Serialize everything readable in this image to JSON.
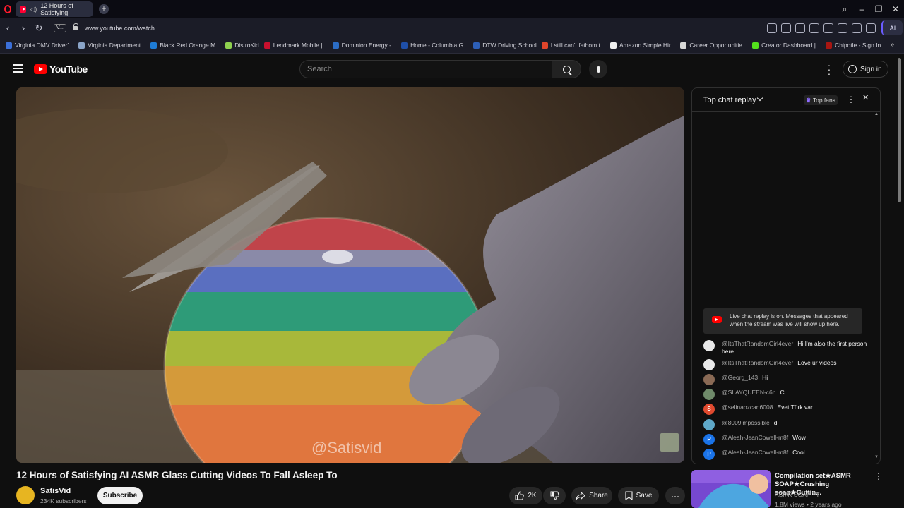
{
  "browser": {
    "tab_title": "12 Hours of Satisfying",
    "url": "www.youtube.com/watch",
    "site_badge": "V...",
    "ai_label": "AI",
    "bookmarks": [
      {
        "label": "Virginia DMV Driver'...",
        "color": "#3b6fd9"
      },
      {
        "label": "Virginia Department...",
        "color": "#8aa4c8"
      },
      {
        "label": "Black Red Orange M...",
        "color": "#1e7cd6"
      },
      {
        "label": "DistroKid",
        "color": "#8fd14f"
      },
      {
        "label": "Lendmark Mobile |...",
        "color": "#c8102e"
      },
      {
        "label": "Dominion Energy -...",
        "color": "#2b6cc4"
      },
      {
        "label": "Home - Columbia G...",
        "color": "#1f4fa8"
      },
      {
        "label": "DTW Driving School",
        "color": "#2d5fb8"
      },
      {
        "label": "I still can't fathom t...",
        "color": "#e0452b"
      },
      {
        "label": "Amazon Simple Hir...",
        "color": "#f0f0f0"
      },
      {
        "label": "Career Opportunitie...",
        "color": "#d8d8d8"
      },
      {
        "label": "Creator Dashboard |...",
        "color": "#53e01c"
      },
      {
        "label": "Chipotle - Sign In",
        "color": "#a81612"
      }
    ]
  },
  "header": {
    "logo_text": "YouTube",
    "search_placeholder": "Search",
    "signin_label": "Sign in"
  },
  "video": {
    "watermark": "@Satisvid",
    "title": "12 Hours of Satisfying AI ASMR Glass Cutting Videos To Fall Asleep To",
    "channel": "SatisVid",
    "subscribers": "234K subscribers",
    "subscribe_label": "Subscribe",
    "like_count": "2K",
    "share_label": "Share",
    "save_label": "Save"
  },
  "chat": {
    "title": "Top chat replay",
    "top_fans_label": "Top fans",
    "notice": "Live chat replay is on. Messages that appeared when the stream was live will show up here.",
    "messages": [
      {
        "author": "@ItsThatRandomGirl4ever",
        "text": "Hi I'm also the first person here",
        "avatar_color": "#e8e8e8",
        "initial": ""
      },
      {
        "author": "@ItsThatRandomGirl4ever",
        "text": "Love ur videos",
        "avatar_color": "#e8e8e8",
        "initial": ""
      },
      {
        "author": "@Georg_143",
        "text": "Hi",
        "avatar_color": "#8a6a55",
        "initial": ""
      },
      {
        "author": "@SLAYQUEEN-c6n",
        "text": "C",
        "avatar_color": "#6f8a6a",
        "initial": ""
      },
      {
        "author": "@selinaozcan6008",
        "text": "Evet Türk var",
        "avatar_color": "#e04a2f",
        "initial": "S"
      },
      {
        "author": "@8009impossible",
        "text": "d",
        "avatar_color": "#5fa8c8",
        "initial": ""
      },
      {
        "author": "@Aleah-JeanCowell-m8f",
        "text": "Wow",
        "avatar_color": "#1a73e8",
        "initial": "P"
      },
      {
        "author": "@Aleah-JeanCowell-m8f",
        "text": "Cool",
        "avatar_color": "#1a73e8",
        "initial": "P"
      }
    ]
  },
  "recommendation": {
    "title": "Compilation set★ASMR SOAP★Crushing soap★Cuttin...",
    "channel": "ASMR SOAP YT",
    "meta": "1.8M views • 2 years ago"
  }
}
